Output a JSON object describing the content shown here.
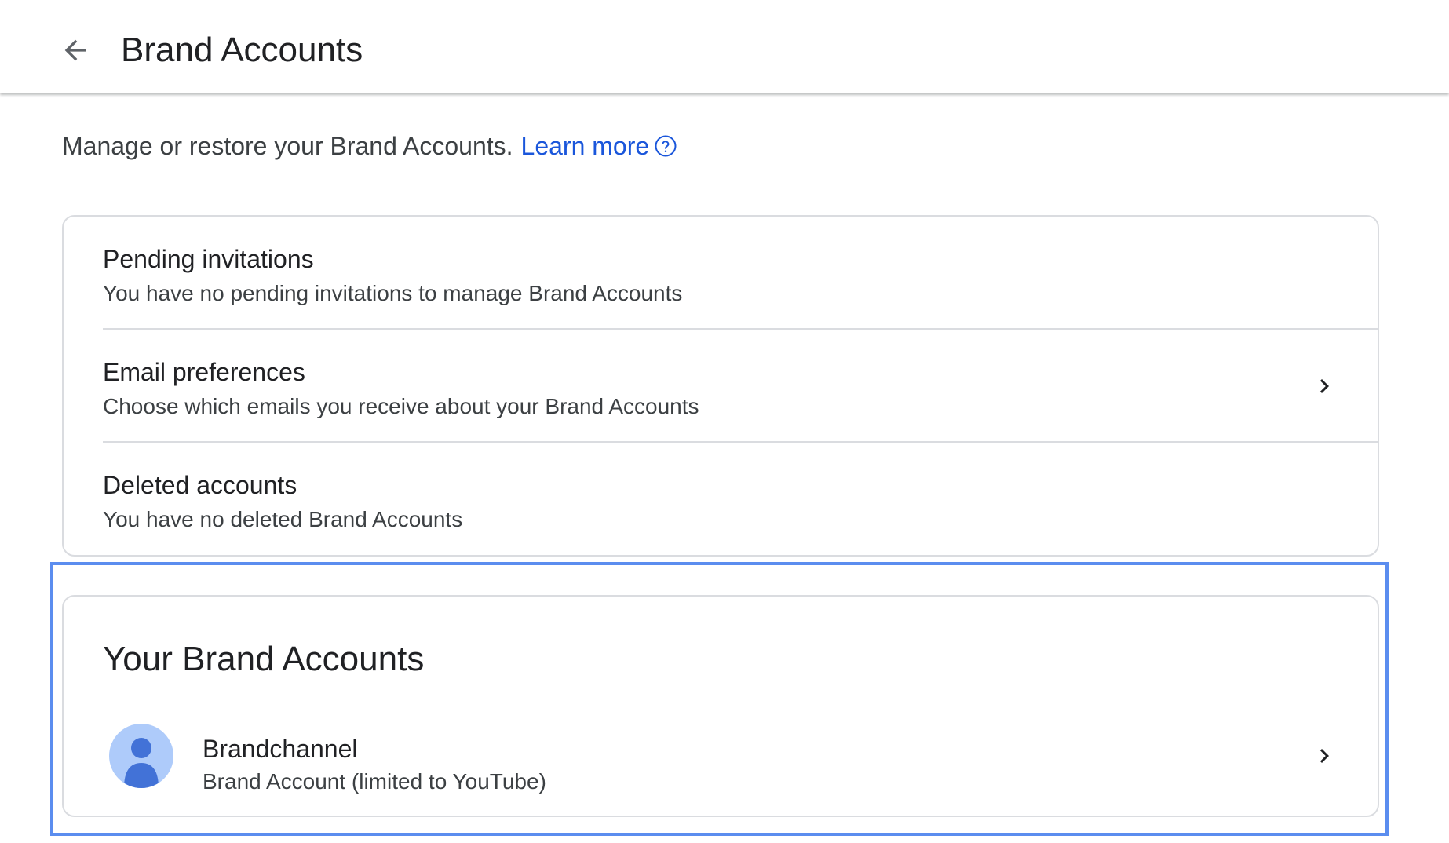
{
  "header": {
    "title": "Brand Accounts",
    "back_icon": "arrow-back-icon"
  },
  "intro": {
    "text": "Manage or restore your Brand Accounts.",
    "link_label": "Learn more",
    "help_icon": "help-circle-icon",
    "link_color": "#1a56db"
  },
  "settings": {
    "pending": {
      "title": "Pending invitations",
      "subtitle": "You have no pending invitations to manage Brand Accounts"
    },
    "email": {
      "title": "Email preferences",
      "subtitle": "Choose which emails you receive about your Brand Accounts",
      "icon": "chevron-right-icon"
    },
    "deleted": {
      "title": "Deleted accounts",
      "subtitle": "You have no deleted Brand Accounts"
    }
  },
  "brand_accounts": {
    "heading": "Your Brand Accounts",
    "items": [
      {
        "name": "Brandchannel",
        "type": "Brand Account (limited to YouTube)",
        "avatar_icon": "person-avatar-icon",
        "avatar_bg": "#aecbfa",
        "avatar_fg": "#4272d7",
        "icon": "chevron-right-icon"
      }
    ]
  },
  "colors": {
    "focus_ring": "#5b8def",
    "border": "#dadce0"
  }
}
